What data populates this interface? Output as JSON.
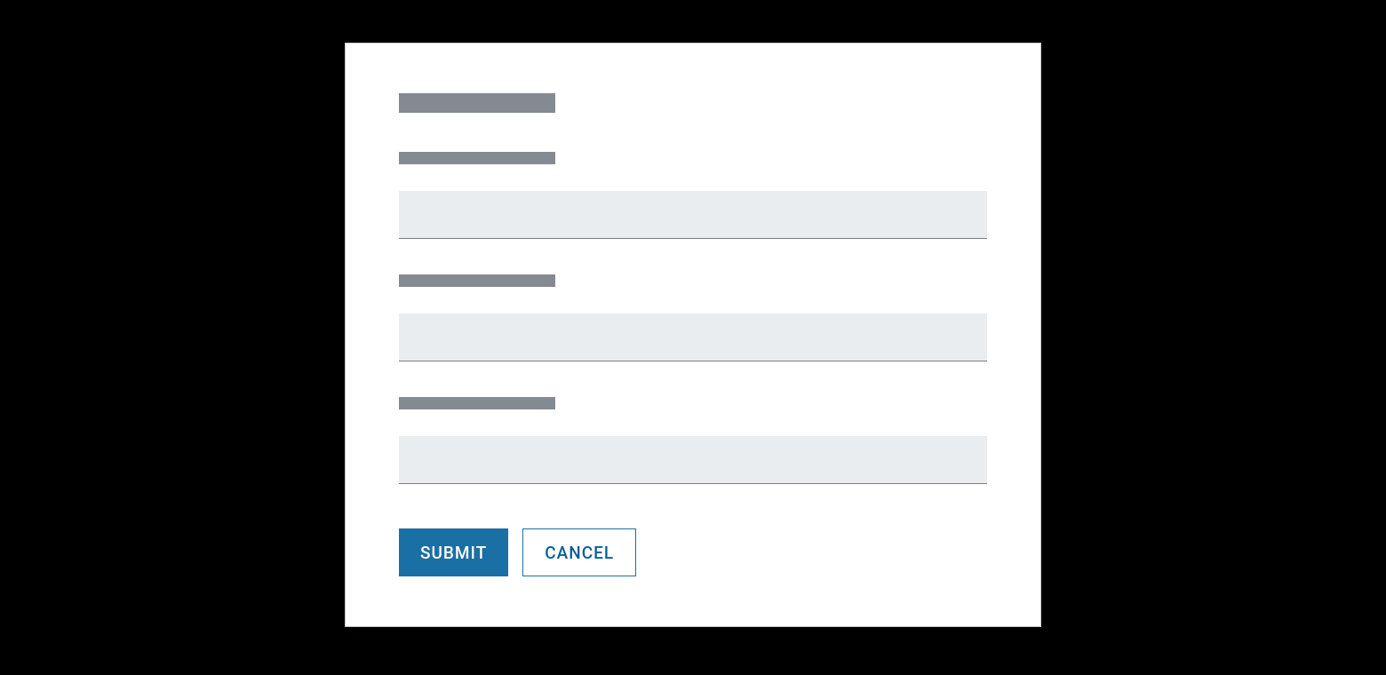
{
  "form": {
    "title_placeholder": "",
    "fields": [
      {
        "label_placeholder": "",
        "value": ""
      },
      {
        "label_placeholder": "",
        "value": ""
      },
      {
        "label_placeholder": "",
        "value": ""
      }
    ],
    "buttons": {
      "submit_label": "SUBMIT",
      "cancel_label": "CANCEL"
    }
  },
  "colors": {
    "primary": "#1a6fa5",
    "placeholder_gray": "#848a91",
    "input_bg": "#e9edf0"
  }
}
